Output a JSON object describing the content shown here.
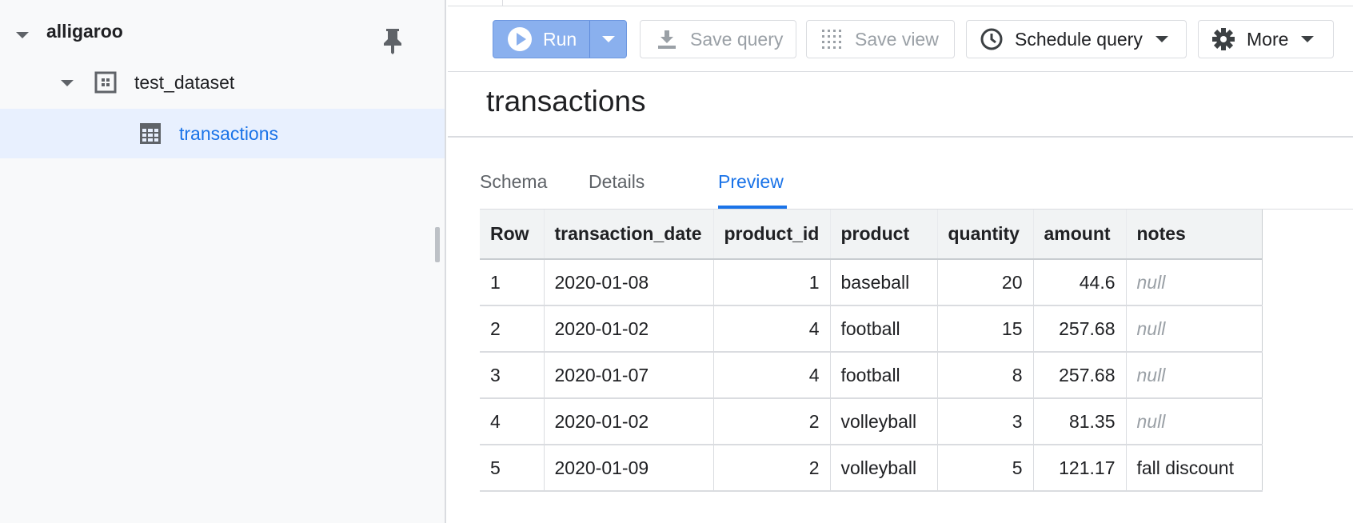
{
  "sidebar": {
    "project": "alligaroo",
    "dataset": "test_dataset",
    "table": "transactions"
  },
  "toolbar": {
    "run_label": "Run",
    "save_query_label": "Save query",
    "save_view_label": "Save view",
    "schedule_query_label": "Schedule query",
    "more_label": "More"
  },
  "page_title": "transactions",
  "tabs": [
    {
      "label": "Schema"
    },
    {
      "label": "Details"
    },
    {
      "label": "Preview"
    }
  ],
  "active_tab": "Preview",
  "table": {
    "headers": [
      "Row",
      "transaction_date",
      "product_id",
      "product",
      "quantity",
      "amount",
      "notes"
    ],
    "rows": [
      [
        "1",
        "2020-01-08",
        "1",
        "baseball",
        "20",
        "44.6",
        "null"
      ],
      [
        "2",
        "2020-01-02",
        "4",
        "football",
        "15",
        "257.68",
        "null"
      ],
      [
        "3",
        "2020-01-07",
        "4",
        "football",
        "8",
        "257.68",
        "null"
      ],
      [
        "4",
        "2020-01-02",
        "2",
        "volleyball",
        "3",
        "81.35",
        "null"
      ],
      [
        "5",
        "2020-01-09",
        "2",
        "volleyball",
        "5",
        "121.17",
        "fall discount"
      ]
    ]
  },
  "colors": {
    "accent": "#1a73e8",
    "run_button": "#8ab0ee",
    "selected_row": "#e8f0fe"
  },
  "icons": {
    "pin": "pin-icon",
    "dataset": "dataset-icon",
    "table": "table-icon",
    "play": "play-icon",
    "save": "download-icon",
    "view": "grid-dots-icon",
    "schedule": "clock-icon",
    "more": "gear-icon"
  }
}
